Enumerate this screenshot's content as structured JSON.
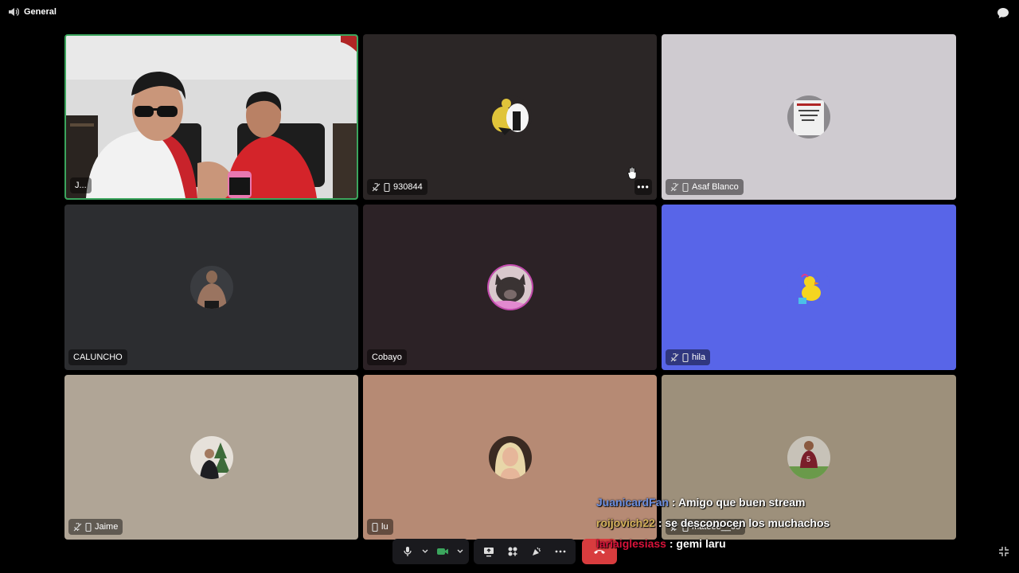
{
  "channel": {
    "name": "General"
  },
  "tiles": [
    {
      "name": "J...",
      "kind": "video",
      "bg": "#d9d9d9"
    },
    {
      "name": "930844",
      "kind": "avatar",
      "bg": "#2b2626",
      "muted": true,
      "mobile": true
    },
    {
      "name": "Asaf Blanco",
      "kind": "avatar",
      "bg": "#cfcbd0",
      "muted": true,
      "mobile": true
    },
    {
      "name": "CALUNCHO",
      "kind": "avatar",
      "bg": "#2c2d30"
    },
    {
      "name": "Cobayo",
      "kind": "avatar",
      "bg": "#2c2226"
    },
    {
      "name": "hila",
      "kind": "avatar",
      "bg": "#5865e8",
      "muted": true,
      "mobile": true
    },
    {
      "name": "Jaime",
      "kind": "avatar",
      "bg": "#b0a596",
      "muted": true,
      "mobile": true
    },
    {
      "name": "lu",
      "kind": "avatar",
      "bg": "#b68a74",
      "mobile": true
    },
    {
      "name": "mateee__05",
      "kind": "avatar",
      "bg": "#9d907b",
      "muted": true,
      "mobile": true
    }
  ],
  "chat": [
    {
      "user": "JuanicardFan",
      "color": "#6d8fe0",
      "message": ": Amigo que buen stream"
    },
    {
      "user": "roijovich22",
      "color": "#d4b15a",
      "message": ": se desconocen los muchachos"
    },
    {
      "user": "lariaiglesiass",
      "color": "#d8123a",
      "message": ": gemi laru"
    }
  ],
  "colors": {
    "speaking_border": "#3ba55d",
    "leave_button": "#d83c3e",
    "camera_on": "#3ba55d"
  }
}
